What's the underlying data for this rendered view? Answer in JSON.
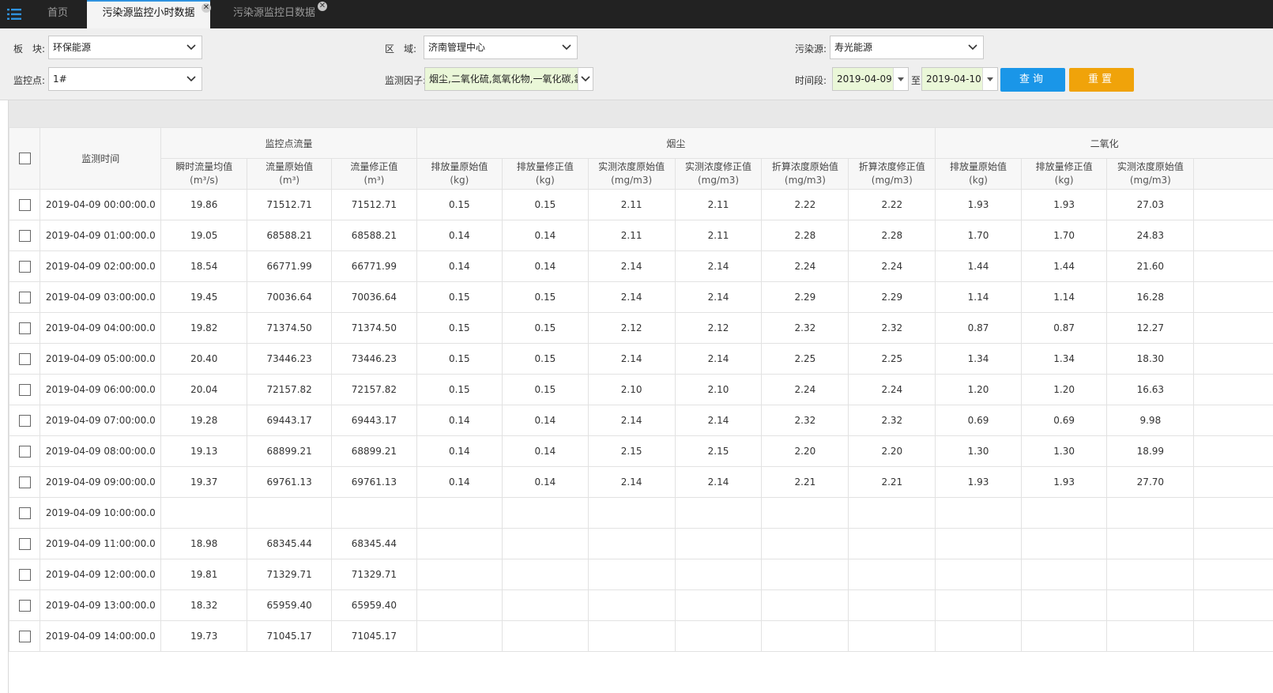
{
  "tabs": [
    {
      "label": "首页",
      "active": false,
      "closable": false
    },
    {
      "label": "污染源监控小时数据",
      "active": true,
      "closable": true
    },
    {
      "label": "污染源监控日数据",
      "active": false,
      "closable": true
    }
  ],
  "filters": {
    "block": {
      "label": "板　块:",
      "value": "环保能源"
    },
    "region": {
      "label": "区　域:",
      "value": "济南管理中心"
    },
    "source": {
      "label": "污染源:",
      "value": "寿光能源"
    },
    "point": {
      "label": "监控点:",
      "value": "1#"
    },
    "factor": {
      "label": "监测因子:",
      "value": "烟尘,二氧化硫,氮氧化物,一氧化碳,氯"
    },
    "period": {
      "label": "时间段:",
      "from": "2019-04-09",
      "to_label": "至",
      "to": "2019-04-10"
    },
    "query_label": "查询",
    "reset_label": "重置"
  },
  "colors": {
    "accent": "#1a96e8",
    "reset": "#f0a30a",
    "topbar": "#222222",
    "factor_bg": "#eaf7d8"
  },
  "grid": {
    "time_header": "监测时间",
    "groups": [
      {
        "label": "监控点流量",
        "span": 3
      },
      {
        "label": "烟尘",
        "span": 6
      },
      {
        "label": "二氧化",
        "span": 4
      }
    ],
    "columns": [
      {
        "name": "瞬时流量均值",
        "unit": "(m³/s)"
      },
      {
        "name": "流量原始值",
        "unit": "(m³)"
      },
      {
        "name": "流量修正值",
        "unit": "(m³)"
      },
      {
        "name": "排放量原始值",
        "unit": "(kg)"
      },
      {
        "name": "排放量修正值",
        "unit": "(kg)"
      },
      {
        "name": "实测浓度原始值",
        "unit": "(mg/m3)"
      },
      {
        "name": "实测浓度修正值",
        "unit": "(mg/m3)"
      },
      {
        "name": "折算浓度原始值",
        "unit": "(mg/m3)"
      },
      {
        "name": "折算浓度修正值",
        "unit": "(mg/m3)"
      },
      {
        "name": "排放量原始值",
        "unit": "(kg)"
      },
      {
        "name": "排放量修正值",
        "unit": "(kg)"
      },
      {
        "name": "实测浓度原始值",
        "unit": "(mg/m3)"
      },
      {
        "name": "",
        "unit": ""
      }
    ],
    "rows": [
      {
        "time": "2019-04-09 00:00:00.0",
        "cells": [
          "19.86",
          "71512.71",
          "71512.71",
          "0.15",
          "0.15",
          "2.11",
          "2.11",
          "2.22",
          "2.22",
          "1.93",
          "1.93",
          "27.03",
          ""
        ]
      },
      {
        "time": "2019-04-09 01:00:00.0",
        "cells": [
          "19.05",
          "68588.21",
          "68588.21",
          "0.14",
          "0.14",
          "2.11",
          "2.11",
          "2.28",
          "2.28",
          "1.70",
          "1.70",
          "24.83",
          ""
        ]
      },
      {
        "time": "2019-04-09 02:00:00.0",
        "cells": [
          "18.54",
          "66771.99",
          "66771.99",
          "0.14",
          "0.14",
          "2.14",
          "2.14",
          "2.24",
          "2.24",
          "1.44",
          "1.44",
          "21.60",
          ""
        ]
      },
      {
        "time": "2019-04-09 03:00:00.0",
        "cells": [
          "19.45",
          "70036.64",
          "70036.64",
          "0.15",
          "0.15",
          "2.14",
          "2.14",
          "2.29",
          "2.29",
          "1.14",
          "1.14",
          "16.28",
          ""
        ]
      },
      {
        "time": "2019-04-09 04:00:00.0",
        "cells": [
          "19.82",
          "71374.50",
          "71374.50",
          "0.15",
          "0.15",
          "2.12",
          "2.12",
          "2.32",
          "2.32",
          "0.87",
          "0.87",
          "12.27",
          ""
        ]
      },
      {
        "time": "2019-04-09 05:00:00.0",
        "cells": [
          "20.40",
          "73446.23",
          "73446.23",
          "0.15",
          "0.15",
          "2.14",
          "2.14",
          "2.25",
          "2.25",
          "1.34",
          "1.34",
          "18.30",
          ""
        ]
      },
      {
        "time": "2019-04-09 06:00:00.0",
        "cells": [
          "20.04",
          "72157.82",
          "72157.82",
          "0.15",
          "0.15",
          "2.10",
          "2.10",
          "2.24",
          "2.24",
          "1.20",
          "1.20",
          "16.63",
          ""
        ]
      },
      {
        "time": "2019-04-09 07:00:00.0",
        "cells": [
          "19.28",
          "69443.17",
          "69443.17",
          "0.14",
          "0.14",
          "2.14",
          "2.14",
          "2.32",
          "2.32",
          "0.69",
          "0.69",
          "9.98",
          ""
        ]
      },
      {
        "time": "2019-04-09 08:00:00.0",
        "cells": [
          "19.13",
          "68899.21",
          "68899.21",
          "0.14",
          "0.14",
          "2.15",
          "2.15",
          "2.20",
          "2.20",
          "1.30",
          "1.30",
          "18.99",
          ""
        ]
      },
      {
        "time": "2019-04-09 09:00:00.0",
        "cells": [
          "19.37",
          "69761.13",
          "69761.13",
          "0.14",
          "0.14",
          "2.14",
          "2.14",
          "2.21",
          "2.21",
          "1.93",
          "1.93",
          "27.70",
          ""
        ]
      },
      {
        "time": "2019-04-09 10:00:00.0",
        "cells": [
          "",
          "",
          "",
          "",
          "",
          "",
          "",
          "",
          "",
          "",
          "",
          "",
          ""
        ]
      },
      {
        "time": "2019-04-09 11:00:00.0",
        "cells": [
          "18.98",
          "68345.44",
          "68345.44",
          "",
          "",
          "",
          "",
          "",
          "",
          "",
          "",
          "",
          ""
        ]
      },
      {
        "time": "2019-04-09 12:00:00.0",
        "cells": [
          "19.81",
          "71329.71",
          "71329.71",
          "",
          "",
          "",
          "",
          "",
          "",
          "",
          "",
          "",
          ""
        ]
      },
      {
        "time": "2019-04-09 13:00:00.0",
        "cells": [
          "18.32",
          "65959.40",
          "65959.40",
          "",
          "",
          "",
          "",
          "",
          "",
          "",
          "",
          "",
          ""
        ]
      },
      {
        "time": "2019-04-09 14:00:00.0",
        "cells": [
          "19.73",
          "71045.17",
          "71045.17",
          "",
          "",
          "",
          "",
          "",
          "",
          "",
          "",
          "",
          ""
        ]
      }
    ]
  }
}
